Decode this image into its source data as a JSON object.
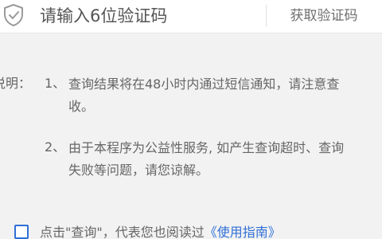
{
  "code_row": {
    "placeholder": "请输入6位验证码",
    "get_code_label": "获取验证码"
  },
  "notes": {
    "label": "说明：",
    "items": [
      {
        "num": "1、",
        "text": "查询结果将在48小时内通过短信通知，请注意查收。"
      },
      {
        "num": "2、",
        "text": "由于本程序为公益性服务, 如产生查询超时、查询失败等问题，请您谅解。"
      }
    ]
  },
  "agreement": {
    "text": "点击\"查询\"，代表您也阅读过",
    "link": "《使用指南》"
  },
  "colors": {
    "accent": "#2f6fd6",
    "background": "#f2f2f2"
  }
}
